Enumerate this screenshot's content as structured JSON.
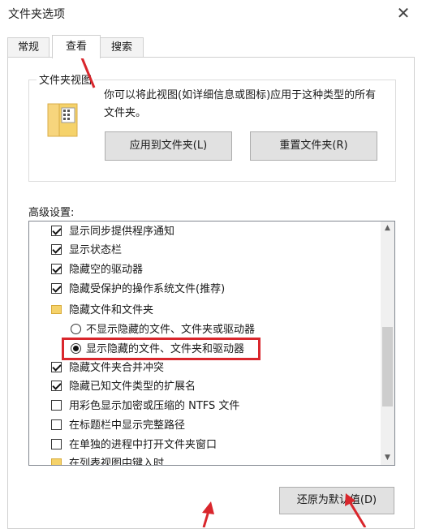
{
  "window": {
    "title": "文件夹选项"
  },
  "tabs": [
    {
      "label": "常规",
      "active": false
    },
    {
      "label": "查看",
      "active": true
    },
    {
      "label": "搜索",
      "active": false
    }
  ],
  "folder_views": {
    "group_label": "文件夹视图",
    "description": "你可以将此视图(如详细信息或图标)应用于这种类型的所有文件夹。",
    "apply_button": "应用到文件夹(L)",
    "reset_button": "重置文件夹(R)"
  },
  "advanced": {
    "label": "高级设置:",
    "items": [
      {
        "type": "checkbox",
        "checked": true,
        "label": "显示同步提供程序通知"
      },
      {
        "type": "checkbox",
        "checked": true,
        "label": "显示状态栏"
      },
      {
        "type": "checkbox",
        "checked": true,
        "label": "隐藏空的驱动器"
      },
      {
        "type": "checkbox",
        "checked": true,
        "label": "隐藏受保护的操作系统文件(推荐)"
      },
      {
        "type": "folder",
        "label": "隐藏文件和文件夹"
      },
      {
        "type": "radio",
        "checked": false,
        "label": "不显示隐藏的文件、文件夹或驱动器"
      },
      {
        "type": "radio",
        "checked": true,
        "label": "显示隐藏的文件、文件夹和驱动器"
      },
      {
        "type": "checkbox",
        "checked": true,
        "label": "隐藏文件夹合并冲突"
      },
      {
        "type": "checkbox",
        "checked": true,
        "label": "隐藏已知文件类型的扩展名"
      },
      {
        "type": "checkbox",
        "checked": false,
        "label": "用彩色显示加密或压缩的 NTFS 文件"
      },
      {
        "type": "checkbox",
        "checked": false,
        "label": "在标题栏中显示完整路径"
      },
      {
        "type": "checkbox",
        "checked": false,
        "label": "在单独的进程中打开文件夹窗口"
      },
      {
        "type": "folder",
        "label": "在列表视图中键入时"
      }
    ]
  },
  "restore_button": "还原为默认值(D)",
  "colors": {
    "annotation_red": "#d9262c"
  }
}
